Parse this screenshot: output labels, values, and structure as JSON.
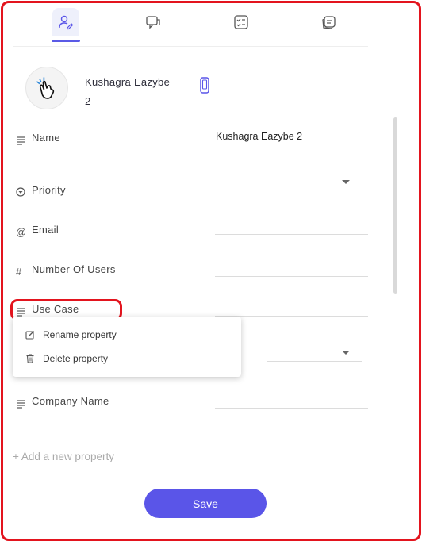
{
  "contact": {
    "name": "Kushagra Eazybe 2"
  },
  "properties": {
    "name": {
      "label": "Name",
      "value": "Kushagra Eazybe 2"
    },
    "priority": {
      "label": "Priority",
      "value": ""
    },
    "email": {
      "label": "Email",
      "value": ""
    },
    "number_of_users": {
      "label": "Number Of Users",
      "value": ""
    },
    "use_case": {
      "label": "Use Case",
      "value": ""
    },
    "company_name": {
      "label": "Company Name",
      "value": ""
    }
  },
  "context_menu": {
    "rename_label": "Rename property",
    "delete_label": "Delete property"
  },
  "add_property_label": "+ Add a new property",
  "save_label": "Save",
  "colors": {
    "accent": "#5a55e8",
    "highlight": "#e3141e"
  }
}
